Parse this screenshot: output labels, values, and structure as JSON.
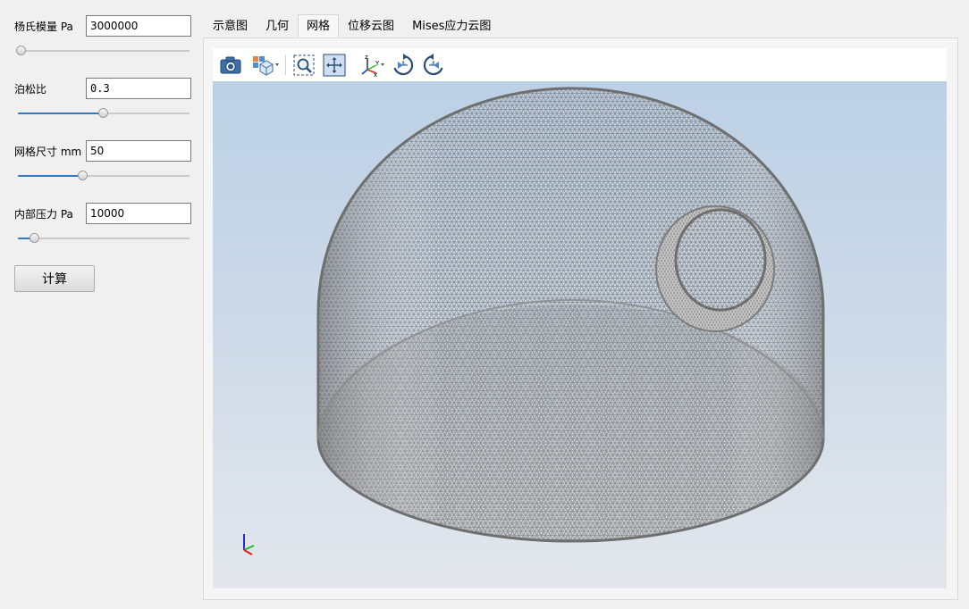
{
  "parameters": [
    {
      "label": "杨氏模量 Pa",
      "value": "3000000",
      "slider_fraction": 0.02
    },
    {
      "label": "泊松比",
      "value": "0.3",
      "slider_fraction": 0.5
    },
    {
      "label": "网格尺寸 mm",
      "value": "50",
      "slider_fraction": 0.38
    },
    {
      "label": "内部压力 Pa",
      "value": "10000",
      "slider_fraction": 0.1
    }
  ],
  "calculate_button": "计算",
  "tabs": [
    {
      "label": "示意图",
      "active": false
    },
    {
      "label": "几何",
      "active": false
    },
    {
      "label": "网格",
      "active": true
    },
    {
      "label": "位移云图",
      "active": false
    },
    {
      "label": "Mises应力云图",
      "active": false
    }
  ],
  "viewer_toolbar": [
    {
      "icon": "camera-icon"
    },
    {
      "icon": "view-cube-icon"
    },
    {
      "icon": "zoom-box-icon"
    },
    {
      "icon": "fit-all-icon"
    },
    {
      "icon": "axes-orientation-icon"
    },
    {
      "icon": "rotate-clockwise-icon"
    },
    {
      "icon": "rotate-counterclockwise-icon"
    }
  ],
  "colors": {
    "slider_fill": "#2f7bbd",
    "mesh": "#8c8c8c",
    "viewport_top": "#bcd0e6",
    "viewport_bottom": "#e3e7ec",
    "axis_x": "#e0201b",
    "axis_y": "#2db81f",
    "axis_z": "#1f2ee6"
  },
  "model": "hemispherical-dome-mesh-with-side-nozzle"
}
